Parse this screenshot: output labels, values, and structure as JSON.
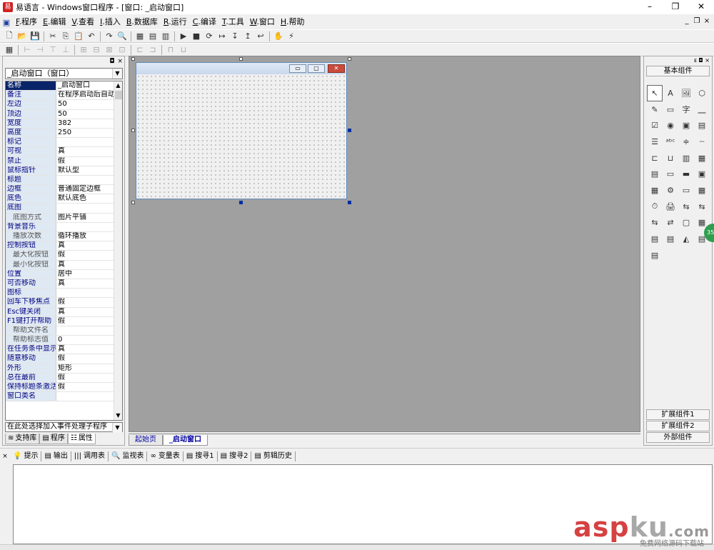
{
  "window": {
    "title": "易语言 - Windows窗口程序 - [窗口: _启动窗口]",
    "minimize": "–",
    "maximize": "❐",
    "close": "✕"
  },
  "menubar": {
    "items": [
      {
        "key": "F",
        "label": ".程序"
      },
      {
        "key": "E",
        "label": ".编辑"
      },
      {
        "key": "V",
        "label": ".查看"
      },
      {
        "key": "I",
        "label": ".插入"
      },
      {
        "key": "B",
        "label": ".数据库"
      },
      {
        "key": "R",
        "label": ".运行"
      },
      {
        "key": "C",
        "label": ".编译"
      },
      {
        "key": "T",
        "label": ".工具"
      },
      {
        "key": "W",
        "label": ".窗口"
      },
      {
        "key": "H",
        "label": ".帮助"
      }
    ],
    "mdi": [
      "_",
      "❐",
      "×"
    ]
  },
  "toolbar1": [
    "🗋",
    "📂",
    "💾",
    "✂",
    "⎘",
    "📋",
    "↶",
    "↷",
    "🔍",
    "▦",
    "▤",
    "▥",
    "▶",
    "■",
    "⟳",
    "↦",
    "↧",
    "↥",
    "↩",
    "✋",
    "⚡"
  ],
  "toolbar2": [
    "▦",
    "⊢",
    "⊣",
    "⊤",
    "⊥",
    "⊞",
    "⊟",
    "⊠",
    "⊡",
    "⊏",
    "⊐",
    "⊓",
    "⊔"
  ],
  "left_panel": {
    "object_combo": "_启动窗口（窗口）",
    "properties": [
      {
        "name": "名称",
        "value": "_启动窗口",
        "selected": true
      },
      {
        "name": "备注",
        "value": "在程序启动后自动"
      },
      {
        "name": "左边",
        "value": "50"
      },
      {
        "name": "顶边",
        "value": "50"
      },
      {
        "name": "宽度",
        "value": "382"
      },
      {
        "name": "高度",
        "value": "250"
      },
      {
        "name": "标记",
        "value": ""
      },
      {
        "name": "可视",
        "value": "真"
      },
      {
        "name": "禁止",
        "value": "假"
      },
      {
        "name": "鼠标指针",
        "value": "默认型"
      },
      {
        "name": "标题",
        "value": ""
      },
      {
        "name": "边框",
        "value": "普通固定边框"
      },
      {
        "name": "底色",
        "value": "默认底色"
      },
      {
        "name": "底图",
        "value": ""
      },
      {
        "name": "底图方式",
        "value": "图片平铺",
        "sub": true
      },
      {
        "name": "背景音乐",
        "value": ""
      },
      {
        "name": "播放次数",
        "value": "循环播放",
        "sub": true
      },
      {
        "name": "控制按钮",
        "value": "真"
      },
      {
        "name": "最大化按钮",
        "value": "假",
        "sub": true
      },
      {
        "name": "最小化按钮",
        "value": "真",
        "sub": true
      },
      {
        "name": "位置",
        "value": "居中"
      },
      {
        "name": "可否移动",
        "value": "真"
      },
      {
        "name": "图标",
        "value": ""
      },
      {
        "name": "回车下移焦点",
        "value": "假"
      },
      {
        "name": "Esc键关闭",
        "value": "真"
      },
      {
        "name": "F1键打开帮助",
        "value": "假"
      },
      {
        "name": "帮助文件名",
        "value": "",
        "sub": true
      },
      {
        "name": "帮助标志值",
        "value": "0",
        "sub": true
      },
      {
        "name": "在任务条中显示",
        "value": "真"
      },
      {
        "name": "随意移动",
        "value": "假"
      },
      {
        "name": "外形",
        "value": "矩形"
      },
      {
        "name": "总在最前",
        "value": "假"
      },
      {
        "name": "保持标题条激活",
        "value": "假"
      },
      {
        "name": "窗口类名",
        "value": ""
      }
    ],
    "event_combo": "在此处选择加入事件处理子程序",
    "tabs": [
      {
        "icon": "≋",
        "label": "支持库"
      },
      {
        "icon": "▤",
        "label": "程序"
      },
      {
        "icon": "☷",
        "label": "属性"
      }
    ]
  },
  "doc_tabs": [
    "起始页",
    "_启动窗口"
  ],
  "right_panel": {
    "header": "ᴇ ◘ ×",
    "top_category": "基本组件",
    "palette": [
      "↖",
      "A",
      "🖼",
      "⬡",
      "✎",
      "▭",
      "字",
      "⎽",
      "☑",
      "◉",
      "▣",
      "▤",
      "☰",
      "ᵃᵇᶜ",
      "≑",
      "┈",
      "⊏",
      "⊔",
      "▥",
      "▦",
      "▤",
      "▭",
      "▬",
      "▣",
      "▦",
      "⚙",
      "▭",
      "▦",
      "⏱",
      "🖨",
      "⇆",
      "⇆",
      "⇆",
      "⇄",
      "▢",
      "▦",
      "▤",
      "▤",
      "◭",
      "▤",
      "▤"
    ],
    "bottom_categories": [
      "扩展组件1",
      "扩展组件2",
      "外部组件"
    ]
  },
  "bottom_tabs": [
    {
      "icon": "💡",
      "label": "提示"
    },
    {
      "icon": "▤",
      "label": "输出"
    },
    {
      "icon": "|||",
      "label": "调用表"
    },
    {
      "icon": "🔍",
      "label": "监视表"
    },
    {
      "icon": "∞",
      "label": "变量表"
    },
    {
      "icon": "▤",
      "label": "搜寻1"
    },
    {
      "icon": "▤",
      "label": "搜寻2"
    },
    {
      "icon": "▤",
      "label": "剪辑历史"
    }
  ],
  "watermark": {
    "text": "asp",
    "text2": "ku",
    "suffix": ".com",
    "sub": "免费网络源码下载站"
  },
  "badge": "35"
}
